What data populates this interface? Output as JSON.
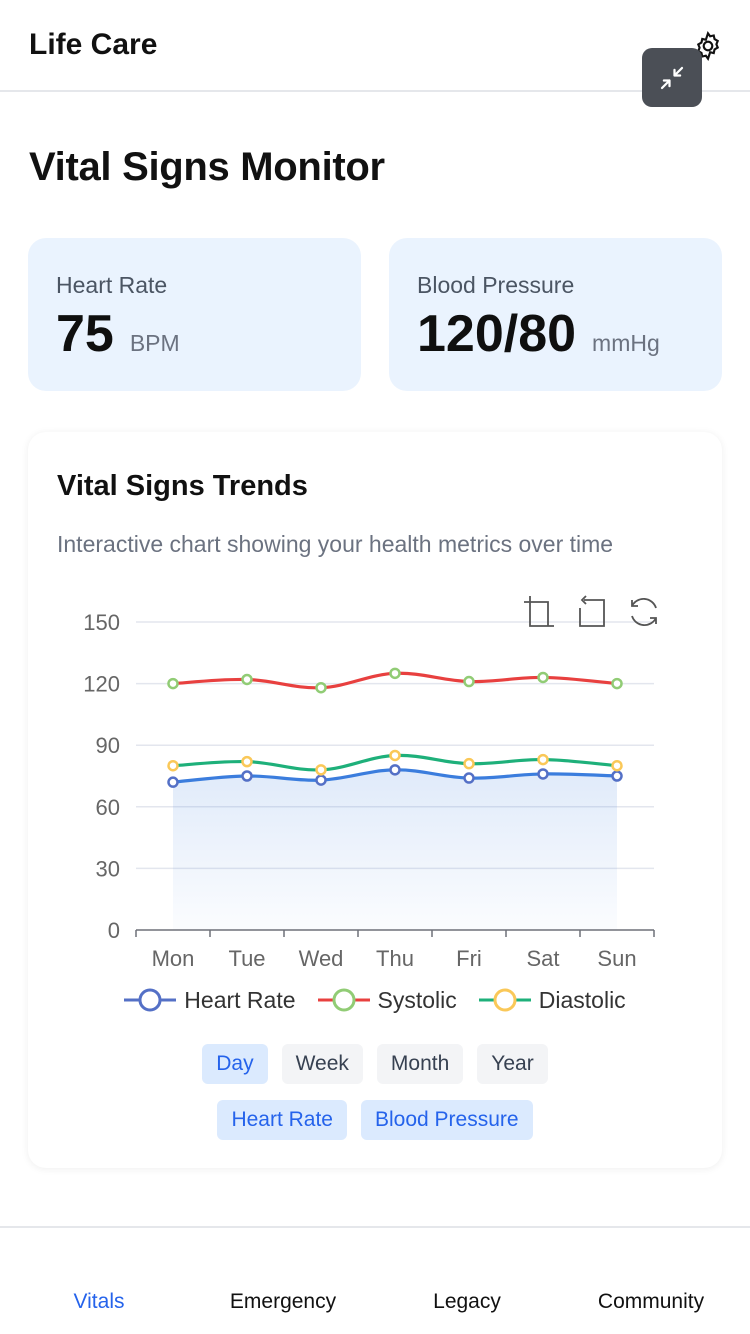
{
  "header": {
    "title": "Life Care"
  },
  "page": {
    "title": "Vital Signs Monitor"
  },
  "cards": {
    "heart_rate": {
      "label": "Heart Rate",
      "value": "75",
      "unit": "BPM"
    },
    "blood_pressure": {
      "label": "Blood Pressure",
      "value": "120/80",
      "unit": "mmHg"
    }
  },
  "chart_panel": {
    "title": "Vital Signs Trends",
    "subtitle": "Interactive chart showing your health metrics over time"
  },
  "chart_data": {
    "type": "line",
    "categories": [
      "Mon",
      "Tue",
      "Wed",
      "Thu",
      "Fri",
      "Sat",
      "Sun"
    ],
    "series": [
      {
        "name": "Heart Rate",
        "values": [
          72,
          75,
          73,
          78,
          74,
          76,
          75
        ],
        "color": "#3b7ddd",
        "marker": "#5470c6",
        "area": true
      },
      {
        "name": "Systolic",
        "values": [
          120,
          122,
          118,
          125,
          121,
          123,
          120
        ],
        "color": "#e8403f",
        "marker": "#91cc75"
      },
      {
        "name": "Diastolic",
        "values": [
          80,
          82,
          78,
          85,
          81,
          83,
          80
        ],
        "color": "#1eb07a",
        "marker": "#fac858"
      }
    ],
    "yticks": [
      "150",
      "120",
      "90",
      "60",
      "30",
      "0"
    ],
    "ylim": [
      0,
      150
    ],
    "grid": true,
    "legend": "bottom"
  },
  "filters": {
    "range": [
      {
        "label": "Day",
        "active": true
      },
      {
        "label": "Week",
        "active": false
      },
      {
        "label": "Month",
        "active": false
      },
      {
        "label": "Year",
        "active": false
      }
    ],
    "metric": [
      {
        "label": "Heart Rate",
        "active": true
      },
      {
        "label": "Blood Pressure",
        "active": true
      }
    ]
  },
  "nav": {
    "items": [
      {
        "label": "Vitals",
        "active": true
      },
      {
        "label": "Emergency",
        "active": false
      },
      {
        "label": "Legacy",
        "active": false
      },
      {
        "label": "Community",
        "active": false
      }
    ]
  },
  "icons": {
    "settings": "gear-icon",
    "collapse": "collapse-icon",
    "toolbox": [
      "zoom-icon",
      "zoom-reset-icon",
      "restore-icon"
    ]
  }
}
